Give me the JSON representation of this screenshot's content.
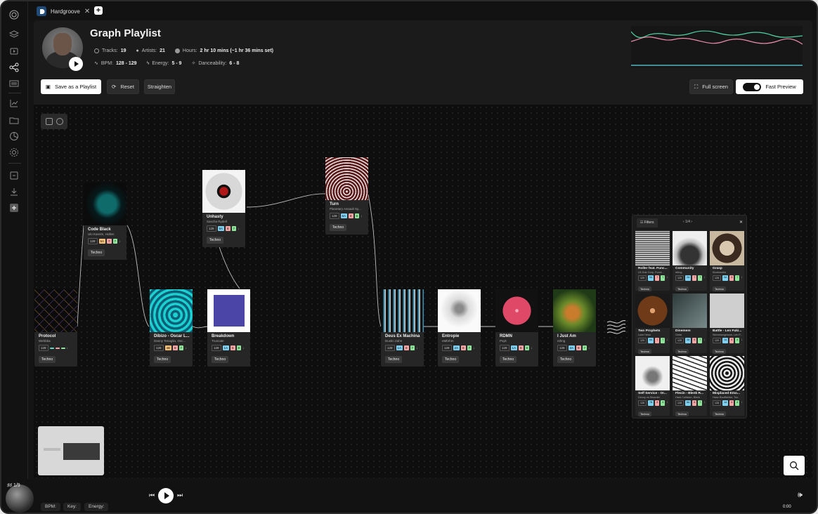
{
  "tab": {
    "title": "Hardgroove",
    "close": "✕",
    "add": "+"
  },
  "header": {
    "title": "Graph Playlist",
    "tracks_label": "Tracks:",
    "tracks": "19",
    "artists_label": "Artists:",
    "artists": "21",
    "hours_label": "Hours:",
    "hours": "2 hr 10 mins (~1 hr 36 mins set)",
    "bpm_label": "BPM:",
    "bpm": "128 - 129",
    "energy_label": "Energy:",
    "energy": "5 - 9",
    "dance_label": "Danceability:",
    "dance": "6 - 8",
    "buttons": {
      "save": "Save as a Playlist",
      "reset": "Reset",
      "straighten": "Straighten",
      "fullscreen": "Full screen",
      "fast_preview": "Fast Preview"
    },
    "colors": {
      "green": "#4fd1a0",
      "pink": "#e88ba8",
      "cyan": "#5fd3e6"
    }
  },
  "tracks": [
    {
      "title": "Protocol",
      "artist": "Wehbba",
      "bpm": "128",
      "chips": [
        [
          "",
          "#66d4c8"
        ],
        [
          "",
          "#f2a5a5"
        ],
        [
          "",
          "#8fe59a"
        ]
      ],
      "genre": "Techno",
      "art": "protocol"
    },
    {
      "title": "Code Black",
      "artist": "Ulo Kareim, Hollen",
      "bpm": "128",
      "chips": [
        [
          "5A",
          "#f5c079"
        ],
        [
          "7",
          "#f2a5a5"
        ],
        [
          "7",
          "#8fe59a"
        ]
      ],
      "genre": "Techno",
      "art": "codeblack"
    },
    {
      "title": "Unhasty",
      "artist": "Sascha Rydell",
      "bpm": "128",
      "chips": [
        [
          "9A",
          "#7fd0f0"
        ],
        [
          "8",
          "#f2a5a5"
        ],
        [
          "7",
          "#8fe59a"
        ]
      ],
      "genre": "Techno",
      "art": "unhasty"
    },
    {
      "title": "Turn",
      "artist": "Planetary Assault Sy...",
      "bpm": "128",
      "chips": [
        [
          "6A",
          "#7fd0f0"
        ],
        [
          "8",
          "#f2a5a5"
        ],
        [
          "8",
          "#8fe59a"
        ]
      ],
      "genre": "Techno",
      "art": "turn"
    },
    {
      "title": "Dibizo - Oscar L...",
      "artist": "Danny Tenaglia, Osc...",
      "bpm": "128",
      "chips": [
        [
          "4B",
          "#f5c079"
        ],
        [
          "8",
          "#f2a5a5"
        ],
        [
          "7",
          "#8fe59a"
        ]
      ],
      "genre": "Techno",
      "art": "dibizo"
    },
    {
      "title": "Breakdown",
      "artist": "Truncate",
      "bpm": "128",
      "chips": [
        [
          "1A",
          "#7fd0f0"
        ],
        [
          "6",
          "#f2a5a5"
        ],
        [
          "8",
          "#8fe59a"
        ]
      ],
      "genre": "Techno",
      "art": "breakdown"
    },
    {
      "title": "Deus Ex Machina",
      "artist": "Dustin Zahn",
      "bpm": "128",
      "chips": [
        [
          "1A",
          "#7fd0f0"
        ],
        [
          "8",
          "#f2a5a5"
        ],
        [
          "7",
          "#8fe59a"
        ]
      ],
      "genre": "Techno",
      "art": "deus"
    },
    {
      "title": "Entropie",
      "artist": "eMbrhm",
      "bpm": "128",
      "chips": [
        [
          "2A",
          "#7fd0f0"
        ],
        [
          "8",
          "#f2a5a5"
        ],
        [
          "7",
          "#8fe59a"
        ]
      ],
      "genre": "Techno",
      "art": "entropie"
    },
    {
      "title": "RDMN",
      "artist": "Psyk",
      "bpm": "128",
      "chips": [
        [
          "1A",
          "#7fd0f0"
        ],
        [
          "8",
          "#f2a5a5"
        ],
        [
          "8",
          "#8fe59a"
        ]
      ],
      "genre": "Techno",
      "art": "rdmn"
    },
    {
      "title": "I Just Am",
      "artist": "nthng",
      "bpm": "128",
      "chips": [
        [
          "2A",
          "#7fd0f0"
        ],
        [
          "9",
          "#f2a5a5"
        ],
        [
          "7",
          "#8fe59a"
        ]
      ],
      "genre": "Techno",
      "art": "ijustam"
    }
  ],
  "panel": {
    "filters": "Filters",
    "page": "1/4",
    "close": "✕",
    "items": [
      {
        "title": "Roller feat. Func...",
        "artist": "LB Dub Corp, Funct...",
        "bpm": "129",
        "chips": [
          [
            "5A",
            "#7fd0f0"
          ],
          [
            "7",
            "#f2a5a5"
          ],
          [
            "7",
            "#8fe59a"
          ]
        ],
        "genre": "Techno",
        "art": "roller"
      },
      {
        "title": "Community",
        "artist": "nthng",
        "bpm": "129",
        "chips": [
          [
            "2A",
            "#7fd0f0"
          ],
          [
            "7",
            "#f2a5a5"
          ],
          [
            "7",
            "#8fe59a"
          ]
        ],
        "genre": "Techno",
        "art": "community"
      },
      {
        "title": "Grasp",
        "artist": "Klockworks",
        "bpm": "128",
        "chips": [
          [
            "5A",
            "#7fd0f0"
          ],
          [
            "8",
            "#f2a5a5"
          ],
          [
            "7",
            "#8fe59a"
          ]
        ],
        "genre": "Techno",
        "art": "grasp"
      },
      {
        "title": "Two Prophets",
        "artist": "Luke Hess",
        "bpm": "129",
        "chips": [
          [
            "6A",
            "#7fd0f0"
          ],
          [
            "7",
            "#f2a5a5"
          ],
          [
            "7",
            "#8fe59a"
          ]
        ],
        "genre": "Techno",
        "art": "twoprophets"
      },
      {
        "title": "Dinemem",
        "artist": "Ontal",
        "bpm": "129",
        "chips": [
          [
            "3A",
            "#7fd0f0"
          ],
          [
            "8",
            "#f2a5a5"
          ],
          [
            "7",
            "#8fe59a"
          ]
        ],
        "genre": "Techno",
        "art": "dinemem"
      },
      {
        "title": "Battle - Len Fuki...",
        "artist": "Wonmrungmoon, Len F...",
        "bpm": "129",
        "chips": [
          [
            "1A",
            "#7fd0f0"
          ],
          [
            "8",
            "#f2a5a5"
          ],
          [
            "8",
            "#8fe59a"
          ]
        ],
        "genre": "Techno",
        "art": "battle"
      },
      {
        "title": "Self Service - Or...",
        "artist": "Decoy vs Disorder",
        "bpm": "128",
        "chips": [
          [
            "7B",
            "#7fd0f0"
          ],
          [
            "8",
            "#f2a5a5"
          ],
          [
            "8",
            "#8fe59a"
          ]
        ],
        "genre": "Techno",
        "art": "selfservice"
      },
      {
        "title": "Flexin - Blenk R...",
        "artist": "Hard Collision, Blenk",
        "bpm": "128",
        "chips": [
          [
            "8A",
            "#7fd0f0"
          ],
          [
            "8",
            "#f2a5a5"
          ],
          [
            "7",
            "#8fe59a"
          ]
        ],
        "genre": "Techno",
        "art": "flexin"
      },
      {
        "title": "Misplaced Emo...",
        "artist": "Hanz Bauffreiher, Too",
        "bpm": "128",
        "chips": [
          [
            "1A",
            "#7fd0f0"
          ],
          [
            "8",
            "#f2a5a5"
          ],
          [
            "8",
            "#8fe59a"
          ]
        ],
        "genre": "Techno",
        "art": "misplaced"
      }
    ]
  },
  "player": {
    "counter": "1/9",
    "bpm": "BPM:",
    "key": "Key:",
    "energy": "Energy:",
    "time": "0:00"
  }
}
